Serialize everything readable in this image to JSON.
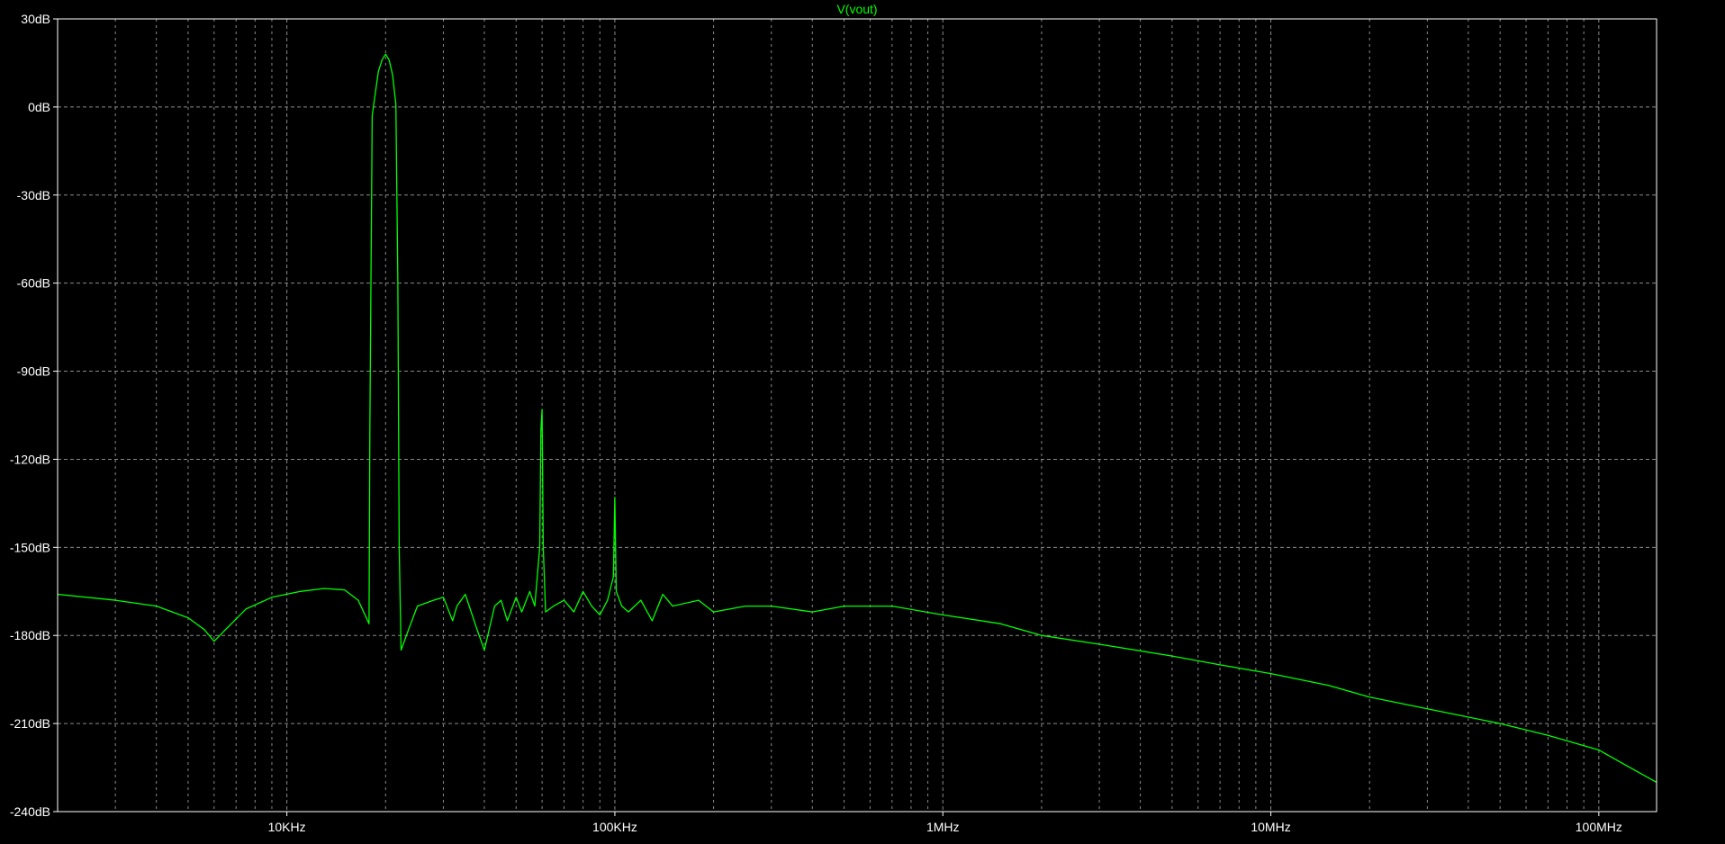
{
  "colors": {
    "background": "#000000",
    "frame": "#ffffff",
    "grid": "#8a8a8a",
    "text": "#ffffff",
    "trace": "#00ff00"
  },
  "chart_data": {
    "type": "line",
    "title": "V(vout)",
    "xlabel": "",
    "ylabel": "",
    "x_scale": "log",
    "xlim": [
      2000,
      150000000
    ],
    "ylim": [
      -240,
      30
    ],
    "grid": true,
    "y_ticks": [
      {
        "value": 30,
        "label": "30dB"
      },
      {
        "value": 0,
        "label": "0dB"
      },
      {
        "value": -30,
        "label": "-30dB"
      },
      {
        "value": -60,
        "label": "-60dB"
      },
      {
        "value": -90,
        "label": "-90dB"
      },
      {
        "value": -120,
        "label": "-120dB"
      },
      {
        "value": -150,
        "label": "-150dB"
      },
      {
        "value": -180,
        "label": "-180dB"
      },
      {
        "value": -210,
        "label": "-210dB"
      },
      {
        "value": -240,
        "label": "-240dB"
      }
    ],
    "x_ticks": [
      {
        "value": 10000,
        "label": "10KHz"
      },
      {
        "value": 100000,
        "label": "100KHz"
      },
      {
        "value": 1000000,
        "label": "1MHz"
      },
      {
        "value": 10000000,
        "label": "10MHz"
      },
      {
        "value": 100000000,
        "label": "100MHz"
      }
    ],
    "series": [
      {
        "color": "#00ff00",
        "x": [
          2000,
          3000,
          4000,
          5000,
          5600,
          6000,
          6500,
          7500,
          9000,
          11000,
          13000,
          15000,
          16500,
          17800,
          17900,
          18200,
          19000,
          19500,
          20000,
          20500,
          21000,
          21500,
          21800,
          22000,
          22300,
          23500,
          25000,
          28000,
          30000,
          32000,
          33000,
          35000,
          38000,
          40000,
          43000,
          45000,
          47000,
          50000,
          52000,
          55000,
          57000,
          59000,
          59500,
          60000,
          60500,
          61500,
          65000,
          70000,
          75000,
          80000,
          85000,
          90000,
          95000,
          99000,
          100000,
          101000,
          105000,
          110000,
          120000,
          130000,
          140000,
          150000,
          180000,
          200000,
          250000,
          300000,
          400000,
          500000,
          700000,
          1000000,
          1500000,
          2000000,
          3000000,
          5000000,
          7000000,
          10000000,
          15000000,
          20000000,
          30000000,
          50000000,
          70000000,
          100000000,
          120000000,
          150000000
        ],
        "y": [
          -166,
          -168,
          -170,
          -174,
          -178,
          -182,
          -178,
          -171,
          -167,
          -165,
          -164,
          -164.5,
          -168,
          -176,
          -110,
          -3,
          12,
          16,
          18,
          16,
          11,
          1,
          -60,
          -150,
          -185,
          -178,
          -170,
          -168,
          -167,
          -175,
          -170,
          -166,
          -178,
          -185,
          -170,
          -168,
          -175,
          -167,
          -172,
          -165,
          -170,
          -150,
          -110,
          -103,
          -150,
          -172,
          -170,
          -168,
          -172,
          -165,
          -170,
          -173,
          -168,
          -160,
          -133,
          -165,
          -170,
          -172,
          -168,
          -175,
          -166,
          -170,
          -168,
          -172,
          -170,
          -170,
          -172,
          -170,
          -170,
          -173,
          -176,
          -180,
          -183,
          -187,
          -190,
          -193,
          -197,
          -201,
          -205,
          -210,
          -214,
          -219,
          -224,
          -230
        ]
      }
    ]
  }
}
